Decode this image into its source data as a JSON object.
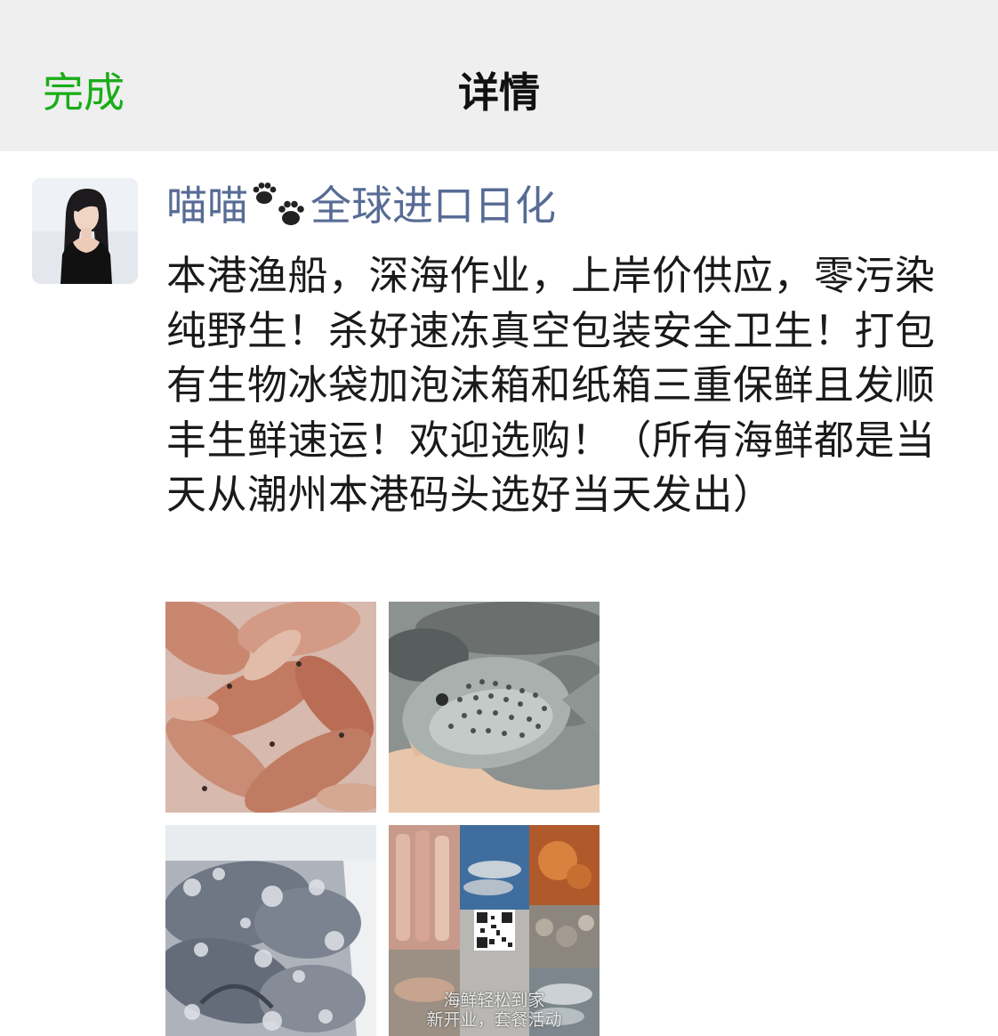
{
  "nav": {
    "done_label": "完成",
    "title": "详情"
  },
  "post": {
    "author_prefix": "喵喵",
    "author_emoji": "paw-prints-icon",
    "author_suffix": "全球进口日化",
    "text": "本港渔船，深海作业，上岸价供应，零污染纯野生！杀好速冻真空包装安全卫生！打包有生物冰袋加泡沫箱和纸箱三重保鲜且发顺丰生鲜速运！欢迎选购！（所有海鲜都是当天从潮州本港码头选好当天发出）",
    "photos": [
      {
        "alt": "red fish"
      },
      {
        "alt": "spotted fish in hand"
      },
      {
        "alt": "frozen fish"
      },
      {
        "alt": "seafood collage",
        "caption_line1": "海鲜轻松到家",
        "caption_line2": "新开业，套餐活动"
      }
    ]
  },
  "colors": {
    "accent_green": "#1aad19",
    "author_blue": "#576b95",
    "nav_bg": "#efefef"
  }
}
